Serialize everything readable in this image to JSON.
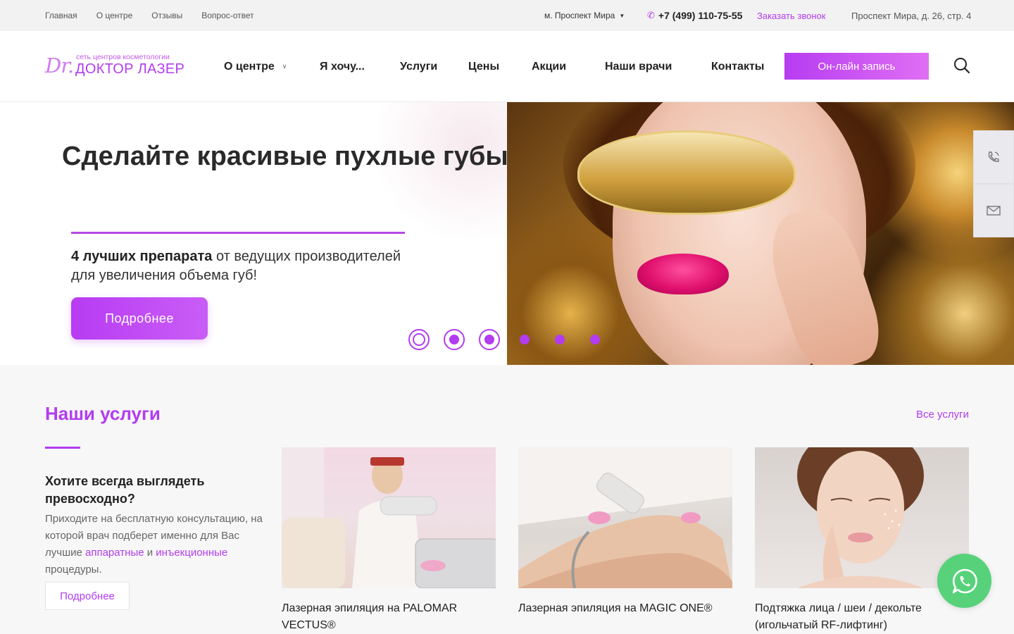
{
  "topbar": {
    "nav": [
      "Главная",
      "О центре",
      "Отзывы",
      "Вопрос-ответ"
    ],
    "metro": "м. Проспект Мира",
    "phone": "+7 (499) 110-75-55",
    "callback": "Заказать звонок",
    "address": "Проспект Мира, д. 26, стр. 4"
  },
  "logo": {
    "dr": "Dr.",
    "subtitle": "сеть центров косметологии",
    "name": "ДОКТОР ЛАЗЕР"
  },
  "mainnav": {
    "items": [
      "О центре",
      "Я хочу...",
      "Услуги",
      "Цены",
      "Акции",
      "Наши врачи",
      "Контакты"
    ],
    "cta": "Он-лайн запись"
  },
  "hero": {
    "title": "Сделайте красивые пухлые губы",
    "text_bold": "4 лучших препарата",
    "text_rest": " от ведущих производителей для увеличения объема губ!",
    "button": "Подробнее",
    "slides_total": 6,
    "active_slide": 1
  },
  "services": {
    "title": "Наши услуги",
    "all_link": "Все услуги",
    "intro_heading": "Хотите всегда выглядеть превосходно?",
    "intro_text_1": "Приходите на бесплатную консультацию, на которой врач подберет именно для Вас лучшие ",
    "intro_link_1": "аппаратные",
    "intro_text_2": " и ",
    "intro_link_2": "инъекционные",
    "intro_text_3": " процедуры.",
    "more_button": "Подробнее",
    "cards": [
      {
        "caption": "Лазерная эпиляция на PALOMAR VECTUS®"
      },
      {
        "caption": "Лазерная эпиляция на MAGIC ONE®"
      },
      {
        "caption": "Подтяжка лица / шеи / декольте (игольчатый RF-лифтинг)"
      }
    ]
  },
  "colors": {
    "accent": "#b23cf0",
    "whatsapp": "#57d27a"
  }
}
